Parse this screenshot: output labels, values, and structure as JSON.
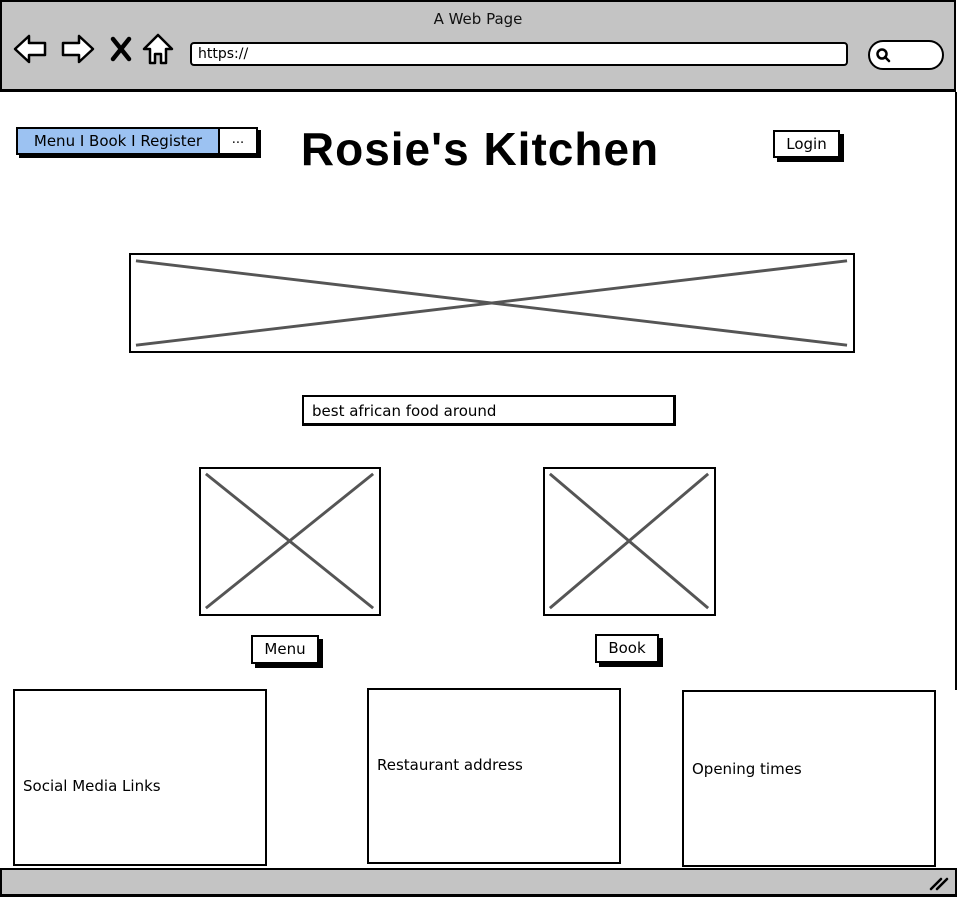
{
  "window": {
    "title": "A Web Page",
    "url": "https://"
  },
  "nav": {
    "links_label": "Menu I Book I Register",
    "more_label": "..."
  },
  "header": {
    "site_title": "Rosie's Kitchen",
    "login_label": "Login"
  },
  "main": {
    "tagline": "best african food around",
    "menu_button_label": "Menu",
    "book_button_label": "Book"
  },
  "footer": {
    "social_label": "Social Media Links",
    "address_label": "Restaurant address",
    "hours_label": "Opening times"
  },
  "colors": {
    "chrome_gray": "#c4c4c4",
    "nav_highlight": "#9cc2f2"
  }
}
